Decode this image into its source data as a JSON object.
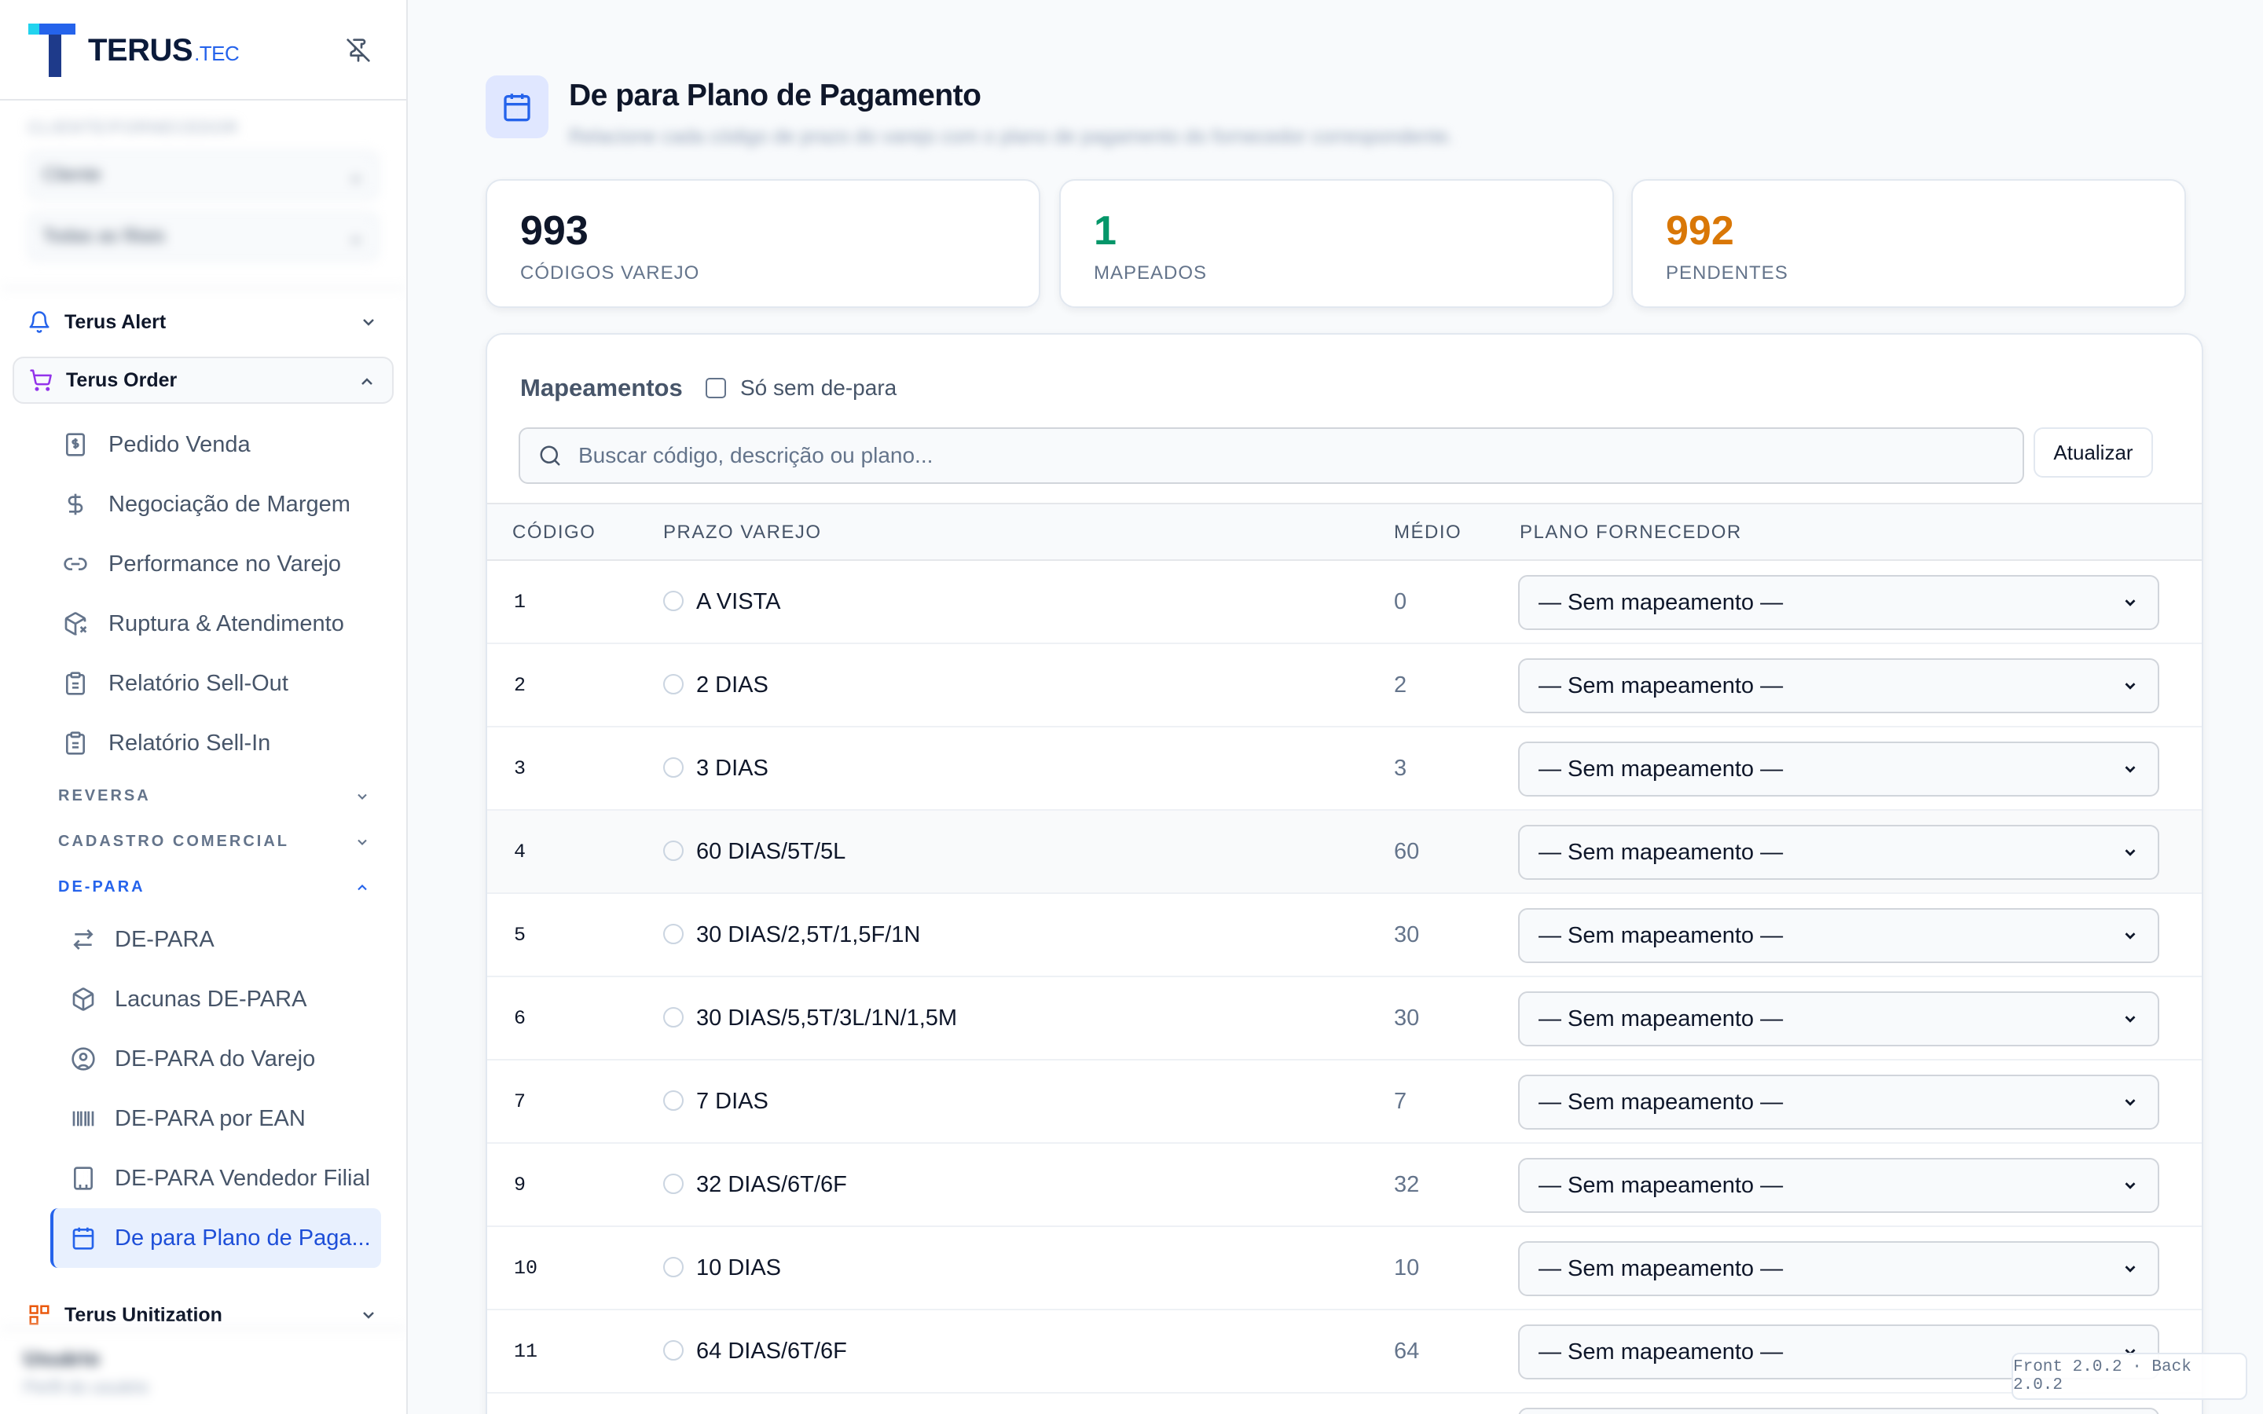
{
  "brand": {
    "name": "TERUS",
    "suffix": ".TEC"
  },
  "filters": {
    "label": "CLIENTE/FORNECEDOR",
    "client": "Cliente",
    "branch": "Todas as filiais"
  },
  "nav": {
    "terus_alert": "Terus Alert",
    "terus_order": "Terus Order",
    "order_items": [
      "Pedido Venda",
      "Negociação de Margem",
      "Performance no Varejo",
      "Ruptura & Atendimento",
      "Relatório Sell-Out",
      "Relatório Sell-In"
    ],
    "sections": {
      "reversa": "REVERSA",
      "cadastro": "CADASTRO COMERCIAL",
      "depara": "DE-PARA"
    },
    "depara_items": [
      "DE-PARA",
      "Lacunas DE-PARA",
      "DE-PARA do Varejo",
      "DE-PARA por EAN",
      "DE-PARA Vendedor Filial",
      "De para Plano de Paga..."
    ],
    "terus_unitization": "Terus Unitization"
  },
  "user": {
    "name": "Usuário",
    "role": "Perfil do usuário"
  },
  "page": {
    "title": "De para Plano de Pagamento",
    "subtitle": "Relacione cada código de prazo do varejo com o plano de pagamento do fornecedor correspondente."
  },
  "stats": [
    {
      "value": "993",
      "label": "CÓDIGOS VAREJO",
      "color": "#0f172a"
    },
    {
      "value": "1",
      "label": "MAPEADOS",
      "color": "#059669"
    },
    {
      "value": "992",
      "label": "PENDENTES",
      "color": "#d97706"
    }
  ],
  "mapping": {
    "title": "Mapeamentos",
    "only_missing_label": "Só sem de-para",
    "search_placeholder": "Buscar código, descrição ou plano...",
    "refresh_label": "Atualizar"
  },
  "table": {
    "columns": {
      "codigo": "CÓDIGO",
      "prazo": "PRAZO VAREJO",
      "medio": "MÉDIO",
      "plano": "PLANO FORNECEDOR"
    },
    "rows": [
      {
        "codigo": "1",
        "prazo": "A VISTA",
        "medio": "0",
        "plano": "— Sem mapeamento —"
      },
      {
        "codigo": "2",
        "prazo": "2 DIAS",
        "medio": "2",
        "plano": "— Sem mapeamento —"
      },
      {
        "codigo": "3",
        "prazo": "3 DIAS",
        "medio": "3",
        "plano": "— Sem mapeamento —"
      },
      {
        "codigo": "4",
        "prazo": "60 DIAS/5T/5L",
        "medio": "60",
        "plano": "— Sem mapeamento —"
      },
      {
        "codigo": "5",
        "prazo": "30 DIAS/2,5T/1,5F/1N",
        "medio": "30",
        "plano": "— Sem mapeamento —"
      },
      {
        "codigo": "6",
        "prazo": "30 DIAS/5,5T/3L/1N/1,5M",
        "medio": "30",
        "plano": "— Sem mapeamento —"
      },
      {
        "codigo": "7",
        "prazo": "7 DIAS",
        "medio": "7",
        "plano": "— Sem mapeamento —"
      },
      {
        "codigo": "9",
        "prazo": "32 DIAS/6T/6F",
        "medio": "32",
        "plano": "— Sem mapeamento —"
      },
      {
        "codigo": "10",
        "prazo": "10 DIAS",
        "medio": "10",
        "plano": "— Sem mapeamento —"
      },
      {
        "codigo": "11",
        "prazo": "64 DIAS/6T/6F",
        "medio": "64",
        "plano": "— Sem mapeamento —"
      },
      {
        "codigo": "",
        "prazo": "",
        "medio": "",
        "plano": ""
      }
    ]
  },
  "version": "Front 2.0.2 · Back 2.0.2",
  "colors": {
    "accent": "#2563eb",
    "mapped": "#059669",
    "pending": "#d97706",
    "brand_dark": "#0b1b3b"
  }
}
